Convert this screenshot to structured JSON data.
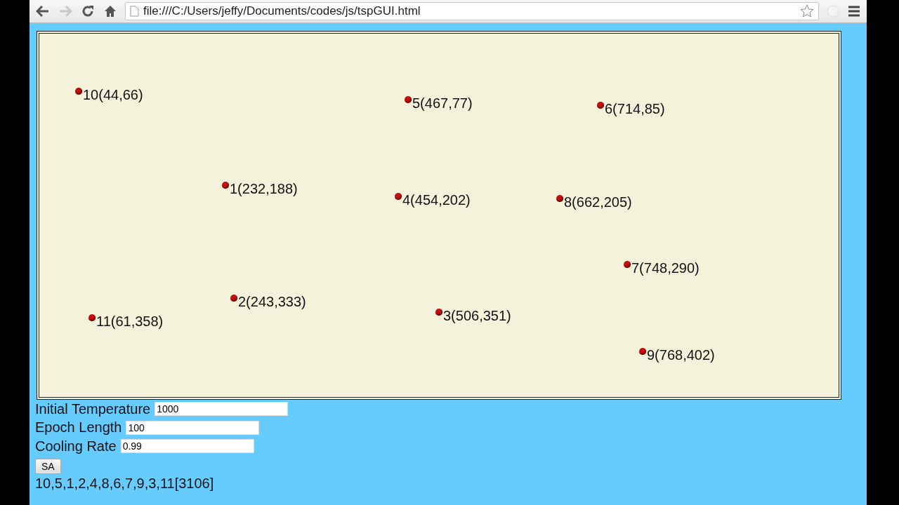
{
  "browser": {
    "url": "file:///C:/Users/jeffy/Documents/codes/js/tspGUI.html",
    "forward_disabled": true
  },
  "canvas": {
    "points": [
      {
        "label": "10(44,66)"
      },
      {
        "label": "5(467,77)"
      },
      {
        "label": "6(714,85)"
      },
      {
        "label": "1(232,188)"
      },
      {
        "label": "4(454,202)"
      },
      {
        "label": "8(662,205)"
      },
      {
        "label": "7(748,290)"
      },
      {
        "label": "2(243,333)"
      },
      {
        "label": "11(61,358)"
      },
      {
        "label": "3(506,351)"
      },
      {
        "label": "9(768,402)"
      }
    ]
  },
  "form": {
    "fields": [
      {
        "label": "Initial Temperature",
        "value": "1000"
      },
      {
        "label": "Epoch Length",
        "value": "100"
      },
      {
        "label": "Cooling Rate",
        "value": "0.99"
      }
    ],
    "button": "SA",
    "result": "10,5,1,2,4,8,6,7,9,3,11[3106]"
  }
}
